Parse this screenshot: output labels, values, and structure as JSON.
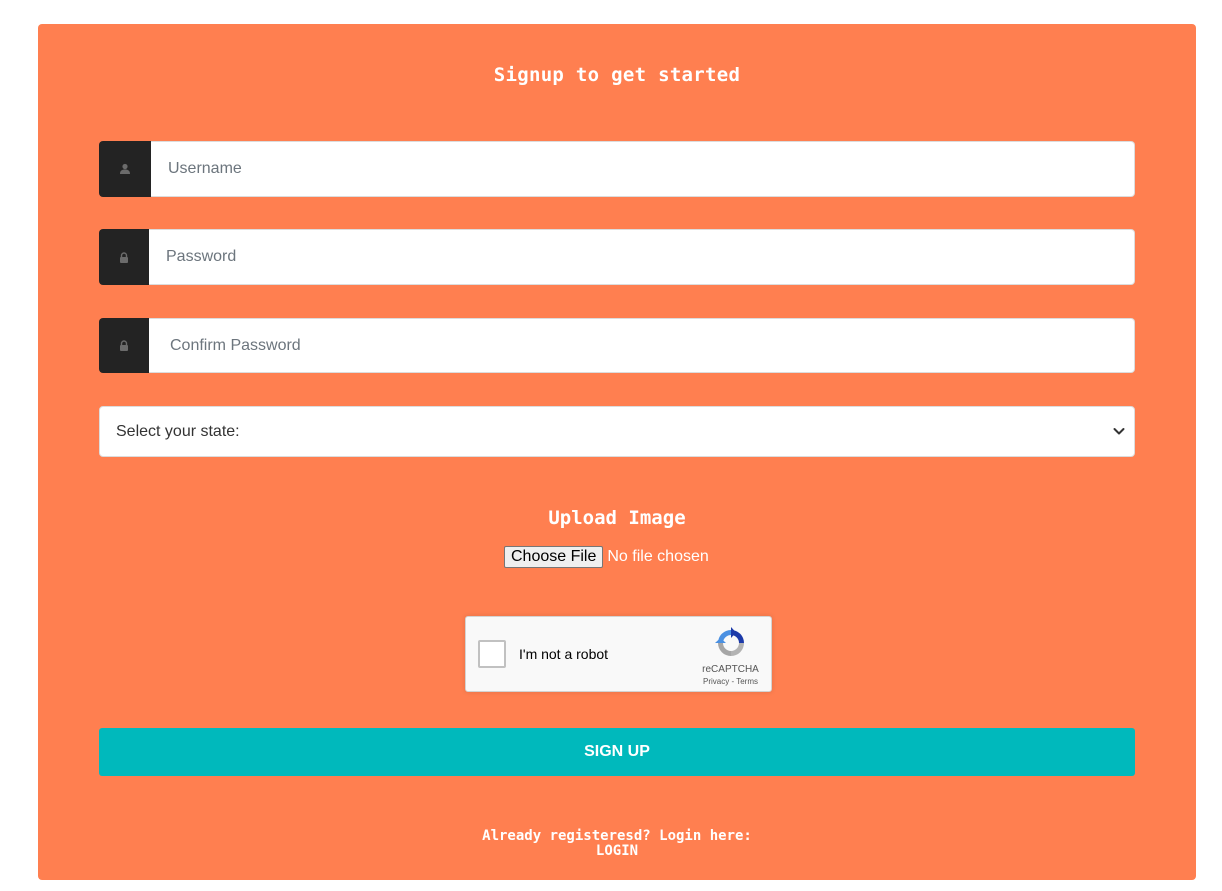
{
  "form": {
    "title": "Signup to get started",
    "username": {
      "placeholder": "Username",
      "icon": "user-icon"
    },
    "password": {
      "placeholder": "Password",
      "icon": "lock-icon"
    },
    "confirm_password": {
      "placeholder": "Confirm Password",
      "icon": "lock-icon"
    },
    "state_select": {
      "selected": "Select your state:"
    },
    "upload": {
      "title": "Upload Image",
      "button_label": "Choose File",
      "status": "No file chosen"
    },
    "recaptcha": {
      "label": "I'm not a robot",
      "brand": "reCAPTCHA",
      "links": "Privacy - Terms"
    },
    "submit_label": "SIGN UP",
    "footer": {
      "prompt": "Already registeresd? Login here:",
      "login_link": "LOGIN"
    }
  },
  "colors": {
    "card_background": "#ff7f50",
    "addon_background": "#232323",
    "submit_background": "#00b9bc"
  }
}
